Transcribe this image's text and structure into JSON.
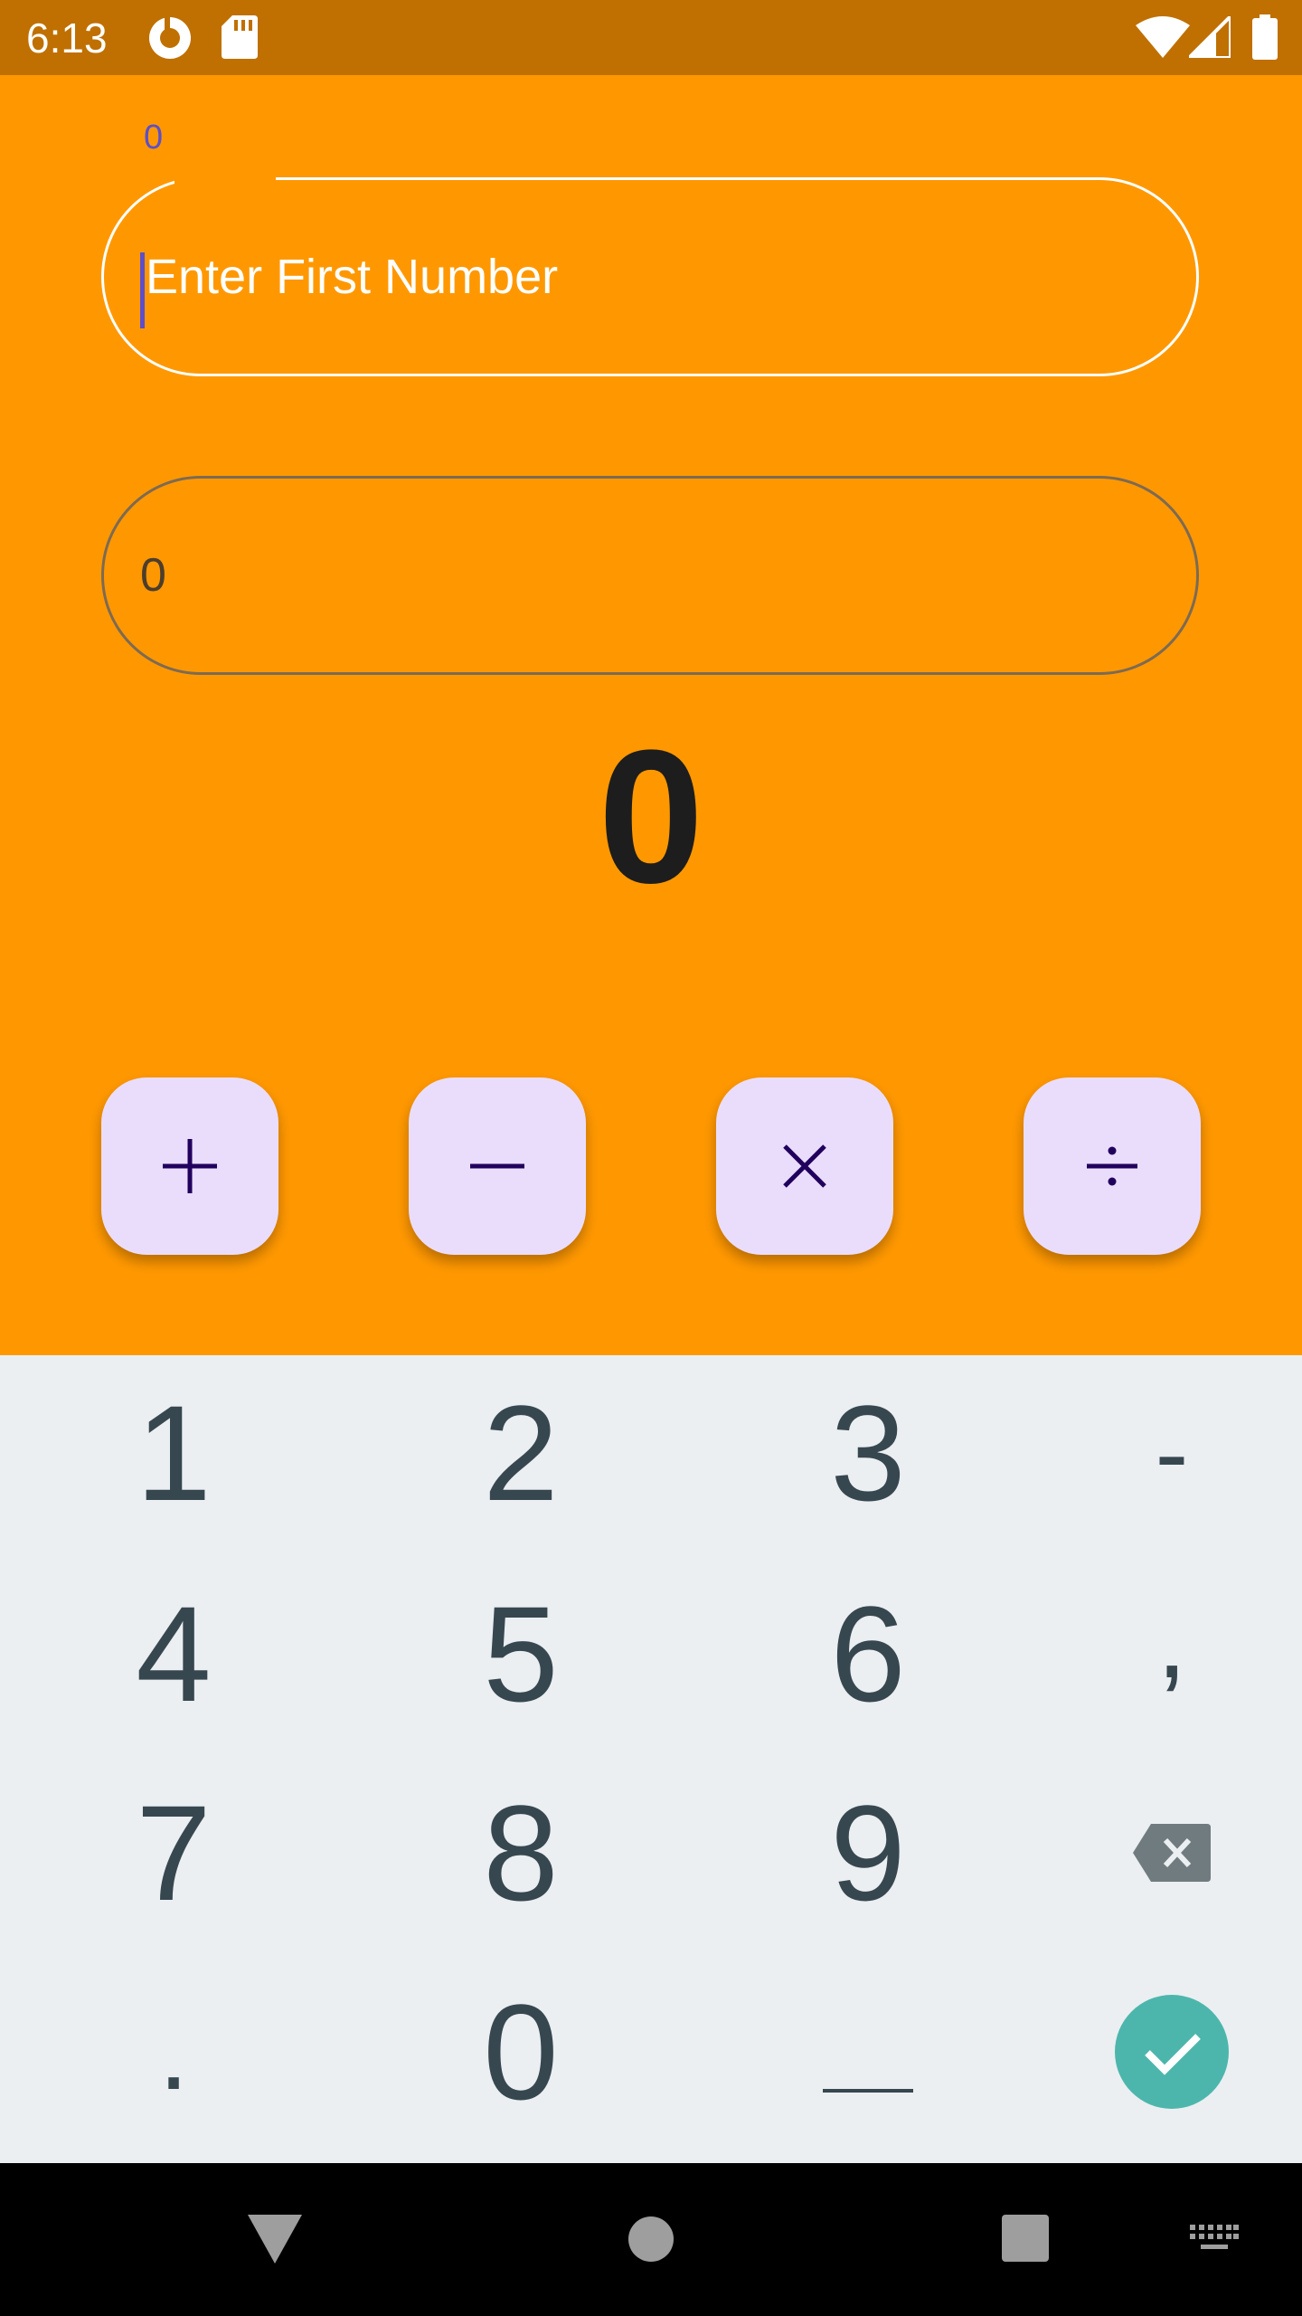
{
  "status_bar": {
    "time": "6:13",
    "icons": [
      "data-saver-icon",
      "sd-card-icon",
      "wifi-icon",
      "signal-icon",
      "battery-icon"
    ]
  },
  "inputs": {
    "first": {
      "label": "0",
      "placeholder": "Enter First Number"
    },
    "second": {
      "value": "0"
    }
  },
  "result": "0",
  "operations": [
    {
      "name": "add",
      "icon": "plus-icon"
    },
    {
      "name": "subtract",
      "icon": "minus-icon"
    },
    {
      "name": "multiply",
      "icon": "times-icon"
    },
    {
      "name": "divide",
      "icon": "divide-icon"
    }
  ],
  "keyboard": {
    "keys": {
      "k1": "1",
      "k2": "2",
      "k3": "3",
      "dash": "-",
      "k4": "4",
      "k5": "5",
      "k6": "6",
      "comma": ",",
      "k7": "7",
      "k8": "8",
      "k9": "9",
      "dot": ".",
      "k0": "0"
    },
    "icons": [
      "backspace-icon",
      "check-icon",
      "space-icon"
    ]
  },
  "colors": {
    "app_background": "#ff9800",
    "status_bar": "#bf7000",
    "button_background": "#eaddfc",
    "button_icon": "#21005d",
    "keyboard_background": "#ebeff2",
    "key_text": "#37474f",
    "enter_key": "#4db6ac"
  },
  "nav_icons": [
    "back-icon",
    "home-icon",
    "recents-icon",
    "keyboard-switch-icon"
  ]
}
